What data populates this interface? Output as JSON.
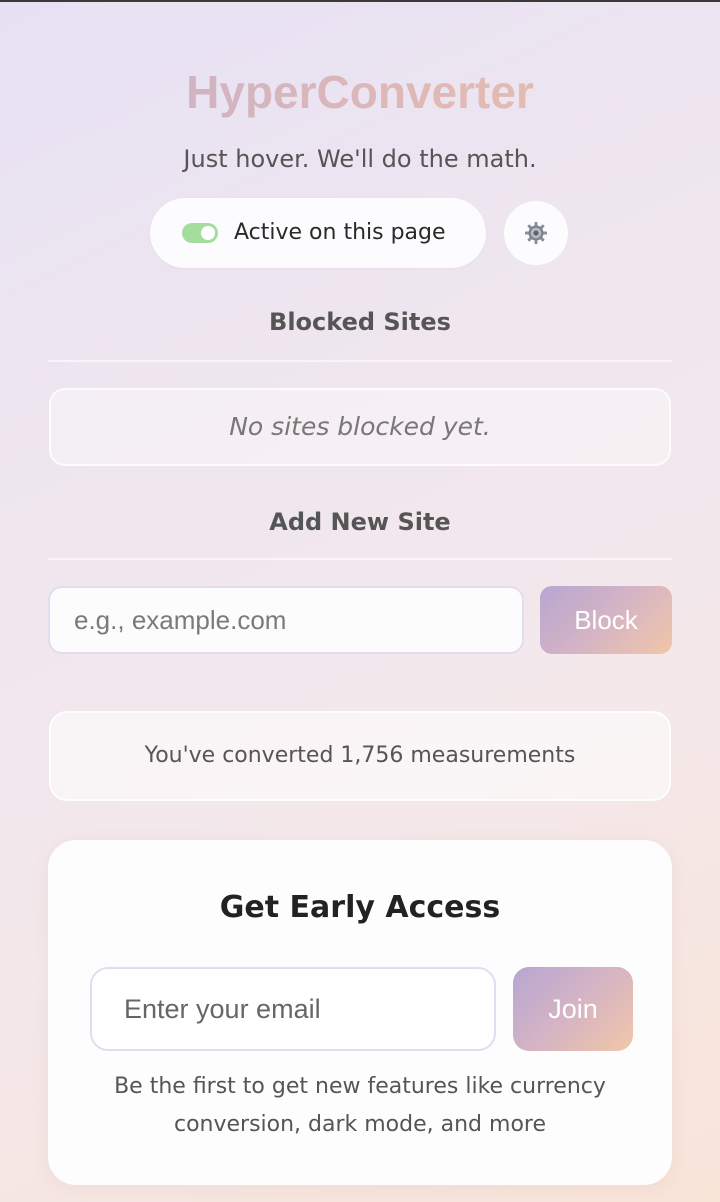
{
  "header": {
    "title": "HyperConverter",
    "tagline": "Just hover. We'll do the math."
  },
  "status": {
    "toggle_on": true,
    "label": "Active on this page",
    "settings_icon": "gear-icon"
  },
  "blocked_sites": {
    "heading": "Blocked Sites",
    "empty_message": "No sites blocked yet.",
    "items": []
  },
  "add_site": {
    "heading": "Add New Site",
    "placeholder": "e.g., example.com",
    "button_label": "Block"
  },
  "stats": {
    "text": "You've converted 1,756 measurements"
  },
  "early_access": {
    "title": "Get Early Access",
    "email_placeholder": "Enter your email",
    "button_label": "Join",
    "note": "Be the first to get new features like currency conversion, dark mode, and more"
  },
  "colors": {
    "toggle_on": "#a5dd9e",
    "gradient_start": "#b7a6d2",
    "gradient_end": "#f1c6a8"
  }
}
